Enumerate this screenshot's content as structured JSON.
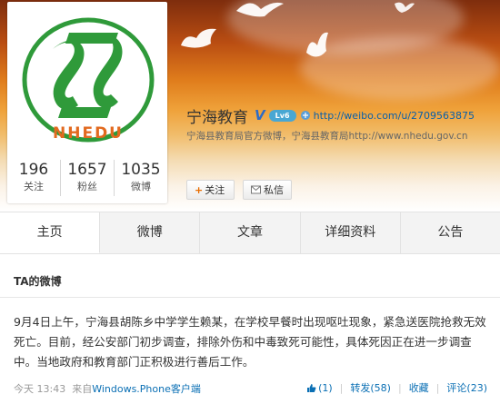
{
  "profile": {
    "name": "宁海教育",
    "url": "http://weibo.com/u/2709563875",
    "intro": "宁海县教育局官方微博，宁海县教育局http://www.nhedu.gov.cn",
    "logo_text": "NHEDU",
    "level_badge": "Lv6",
    "stats": [
      {
        "num": "196",
        "label": "关注"
      },
      {
        "num": "1657",
        "label": "粉丝"
      },
      {
        "num": "1035",
        "label": "微博"
      }
    ],
    "buttons": {
      "follow": "关注",
      "message": "私信"
    }
  },
  "tabs": [
    "主页",
    "微博",
    "文章",
    "详细资料",
    "公告"
  ],
  "feed": {
    "title": "TA的微博",
    "post": {
      "text": "9月4日上午，宁海县胡陈乡中学学生赖某，在学校早餐时出现呕吐现象，紧急送医院抢救无效死亡。目前，经公安部门初步调查，排除外伤和中毒致死可能性，具体死因正在进一步调查中。当地政府和教育部门正积极进行善后工作。",
      "time": "今天 13:43",
      "source_prefix": "来自",
      "source": "Windows.Phone客户端",
      "likes": "(1)",
      "repost": "转发(58)",
      "favorite": "收藏",
      "comment": "评论(23)"
    }
  },
  "colors": {
    "link": "#0a6fb4",
    "logo_green": "#2f9a3a",
    "logo_orange": "#e26a1f"
  }
}
